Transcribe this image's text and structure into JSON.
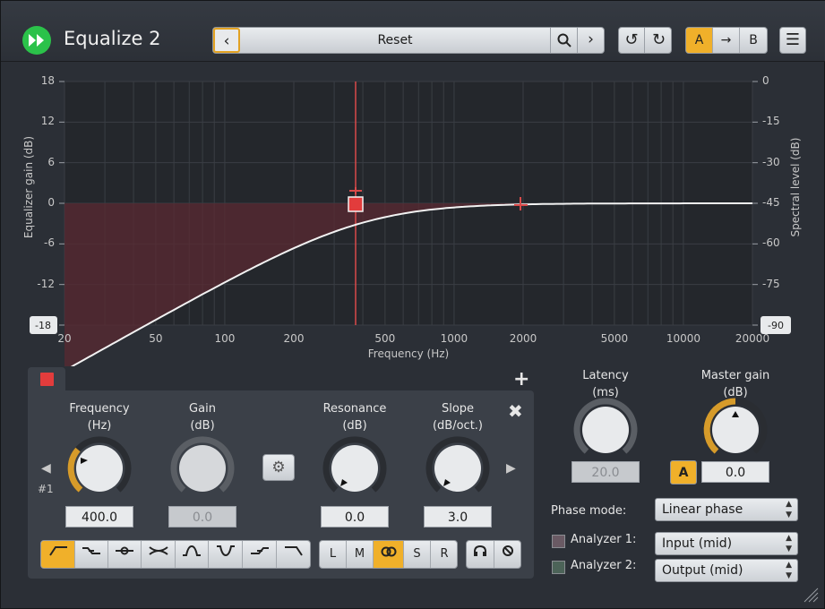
{
  "app": {
    "title": "Equalize 2",
    "preset": "Reset",
    "ab": {
      "a": "A",
      "b": "B"
    },
    "icons": {
      "logo": "play-forward-icon",
      "prev": "chevron-left-icon",
      "search": "search-icon",
      "next": "chevron-right-icon",
      "undo": "undo-icon",
      "redo": "redo-icon",
      "copy": "arrow-right-icon",
      "menu": "hamburger-icon"
    }
  },
  "graph": {
    "left_axis_label": "Equalizer gain (dB)",
    "right_axis_label": "Spectral level (dB)",
    "x_axis_label": "Frequency (Hz)",
    "left_ticks": [
      "18",
      "12",
      "6",
      "0",
      "-6",
      "-12",
      "-18"
    ],
    "right_ticks": [
      "0",
      "-15",
      "-30",
      "-45",
      "-60",
      "-75",
      "-90"
    ],
    "x_ticks": [
      "20",
      "50",
      "100",
      "200",
      "500",
      "1000",
      "2000",
      "5000",
      "10000",
      "20000"
    ],
    "accent": "#e23c3c"
  },
  "band": {
    "index": "#1",
    "color": "#e23c3c",
    "frequency": {
      "label": "Frequency",
      "unit": "(Hz)",
      "value": "400.0"
    },
    "gain": {
      "label": "Gain",
      "unit": "(dB)",
      "value": "0.0"
    },
    "resonance": {
      "label": "Resonance",
      "unit": "(dB)",
      "value": "0.0"
    },
    "slope": {
      "label": "Slope",
      "unit": "(dB/oct.)",
      "value": "3.0"
    },
    "channels": [
      "L",
      "M",
      "S",
      "R"
    ],
    "filter_types": [
      "high-pass-icon",
      "low-shelf-icon",
      "peak-icon",
      "notch-icon",
      "band-pass-icon",
      "band-stop-icon",
      "high-shelf-icon",
      "low-pass-icon"
    ]
  },
  "latency": {
    "label": "Latency",
    "unit": "(ms)",
    "value": "20.0"
  },
  "master": {
    "label": "Master gain",
    "unit": "(dB)",
    "value": "0.0",
    "auto": "A"
  },
  "phase_mode": {
    "label": "Phase mode:",
    "value": "Linear phase"
  },
  "analyzer1": {
    "label": "Analyzer 1:",
    "value": "Input (mid)",
    "color": "#6a5a64"
  },
  "analyzer2": {
    "label": "Analyzer 2:",
    "value": "Output (mid)",
    "color": "#4c6358"
  }
}
